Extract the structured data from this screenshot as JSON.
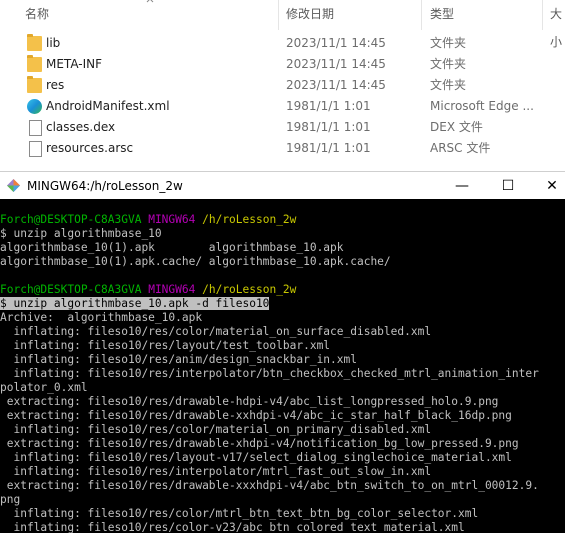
{
  "explorer": {
    "columns": {
      "name": "名称",
      "modified": "修改日期",
      "type": "类型",
      "size": "大小"
    },
    "files": [
      {
        "name": "lib",
        "modified": "2023/11/1 14:45",
        "type": "文件夹",
        "icon": "folder-icon"
      },
      {
        "name": "META-INF",
        "modified": "2023/11/1 14:45",
        "type": "文件夹",
        "icon": "folder-icon"
      },
      {
        "name": "res",
        "modified": "2023/11/1 14:45",
        "type": "文件夹",
        "icon": "folder-icon"
      },
      {
        "name": "AndroidManifest.xml",
        "modified": "1981/1/1 1:01",
        "type": "Microsoft Edge ...",
        "icon": "edge-icon"
      },
      {
        "name": "classes.dex",
        "modified": "1981/1/1 1:01",
        "type": "DEX 文件",
        "icon": "document-icon"
      },
      {
        "name": "resources.arsc",
        "modified": "1981/1/1 1:01",
        "type": "ARSC 文件",
        "icon": "document-icon"
      }
    ]
  },
  "terminal": {
    "title": "MINGW64:/h/roLesson_2w",
    "controls": {
      "minimize": "—",
      "maximize": "☐",
      "close": "✕"
    },
    "prompt1": {
      "user": "Forch@DESKTOP-C8A3GVA",
      "shell": "MINGW64",
      "path": "/h/roLesson_2w"
    },
    "cmd1": "$ unzip algorithmbase_10",
    "out1": [
      "algorithmbase_10(1).apk        algorithmbase_10.apk",
      "algorithmbase_10(1).apk.cache/ algorithmbase_10.apk.cache/"
    ],
    "prompt2": {
      "user": "Forch@DESKTOP-C8A3GVA",
      "shell": "MINGW64",
      "path": "/h/roLesson_2w"
    },
    "cmd2": "$ unzip algorithmbase_10.apk -d fileso10",
    "out2": [
      "Archive:  algorithmbase_10.apk",
      "  inflating: fileso10/res/color/material_on_surface_disabled.xml",
      "  inflating: fileso10/res/layout/test_toolbar.xml",
      "  inflating: fileso10/res/anim/design_snackbar_in.xml",
      "  inflating: fileso10/res/interpolator/btn_checkbox_checked_mtrl_animation_inter",
      "polator_0.xml",
      " extracting: fileso10/res/drawable-hdpi-v4/abc_list_longpressed_holo.9.png",
      " extracting: fileso10/res/drawable-xxhdpi-v4/abc_ic_star_half_black_16dp.png",
      "  inflating: fileso10/res/color/material_on_primary_disabled.xml",
      " extracting: fileso10/res/drawable-xhdpi-v4/notification_bg_low_pressed.9.png",
      "  inflating: fileso10/res/layout-v17/select_dialog_singlechoice_material.xml",
      "  inflating: fileso10/res/interpolator/mtrl_fast_out_slow_in.xml",
      " extracting: fileso10/res/drawable-xxxhdpi-v4/abc_btn_switch_to_on_mtrl_00012.9.",
      "png",
      "  inflating: fileso10/res/color/mtrl_btn_text_btn_bg_color_selector.xml",
      "  inflating: fileso10/res/color-v23/abc_btn_colored_text_material.xml"
    ]
  }
}
